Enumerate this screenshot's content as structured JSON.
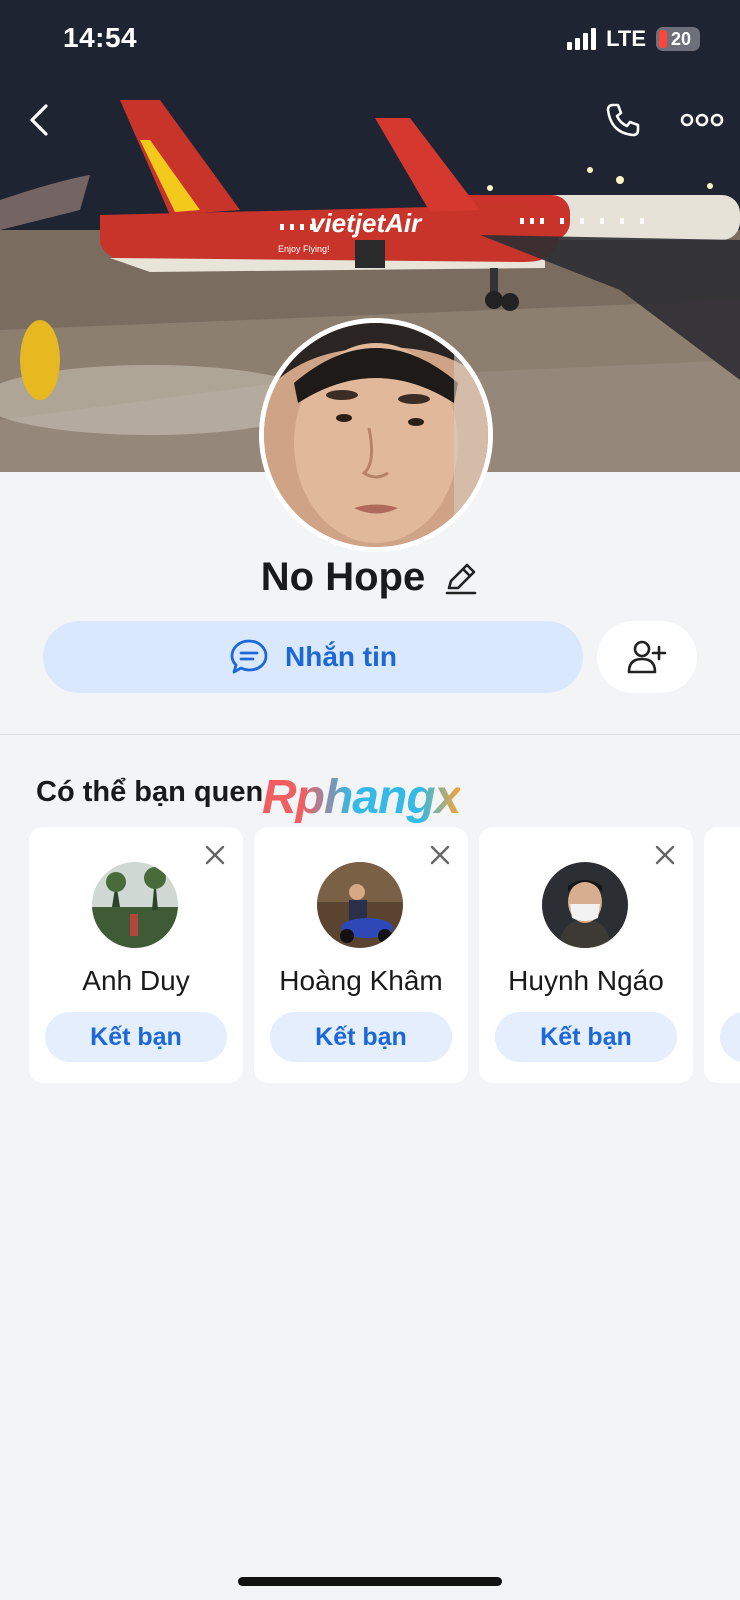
{
  "status_bar": {
    "time": "14:54",
    "network": "LTE",
    "battery": "20"
  },
  "top_nav": {
    "back_icon": "chevron-left-icon",
    "call_icon": "phone-icon",
    "more_icon": "more-horizontal-icon"
  },
  "cover": {
    "airline_text": "vietjetAir.com",
    "tagline": "Enjoy Flying!"
  },
  "profile": {
    "name": "No Hope",
    "edit_icon": "pencil-icon"
  },
  "actions": {
    "message_label": "Nhắn tin",
    "message_icon": "chat-bubble-icon",
    "add_friend_icon": "add-user-icon"
  },
  "suggestions": {
    "title": "Có thể bạn quen",
    "watermark": "Rphangx",
    "items": [
      {
        "name": "Anh Duy",
        "button": "Kết bạn"
      },
      {
        "name": "Hoàng Khâm",
        "button": "Kết bạn"
      },
      {
        "name": "Huynh Ngáo",
        "button": "Kết bạn"
      },
      {
        "name": "",
        "button": ""
      }
    ]
  },
  "colors": {
    "accent": "#1d68d8",
    "accent_light": "#d9e8fc",
    "background": "#f3f4f6"
  }
}
